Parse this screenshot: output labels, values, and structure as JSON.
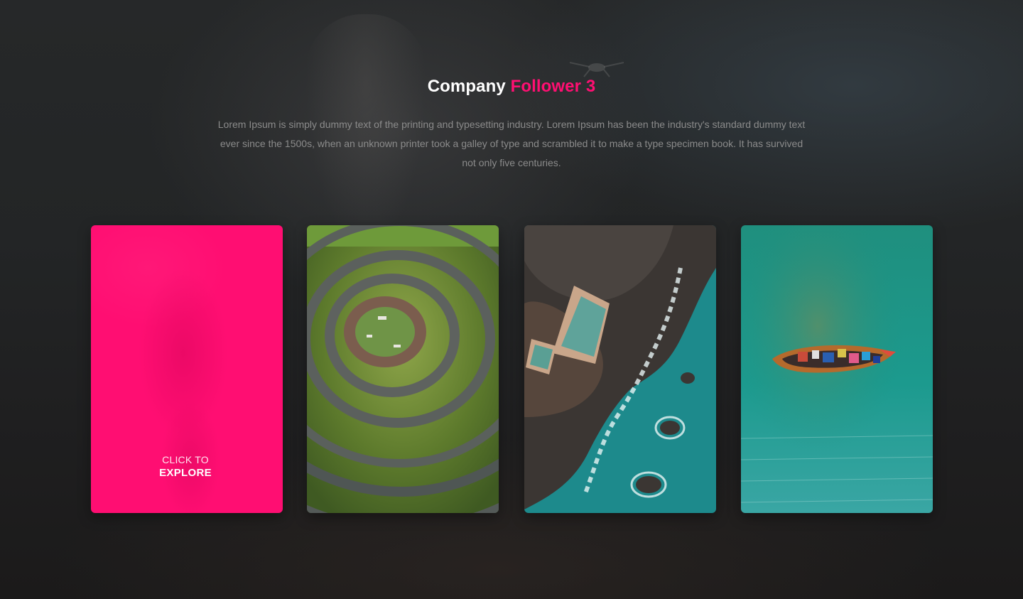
{
  "section": {
    "title_main": "Company",
    "title_accent": "Follower 3",
    "description": "Lorem Ipsum is simply dummy text of the printing and typesetting industry. Lorem Ipsum has been the industry's standard dummy text ever since the 1500s, when an unknown printer took a galley of type and scrambled it to make a type specimen book. It has survived not only five centuries."
  },
  "cards": [
    {
      "kind": "cta",
      "line1": "CLICK TO",
      "line2": "EXPLORE"
    },
    {
      "kind": "image",
      "image": "aerial-spiral-park"
    },
    {
      "kind": "image",
      "image": "aerial-rock-pool-coast"
    },
    {
      "kind": "image",
      "image": "aerial-boat-turquoise-sea"
    }
  ],
  "colors": {
    "accent": "#ff0f72",
    "background": "#232425",
    "title": "#ffffff",
    "description": "#8b8b8b"
  }
}
